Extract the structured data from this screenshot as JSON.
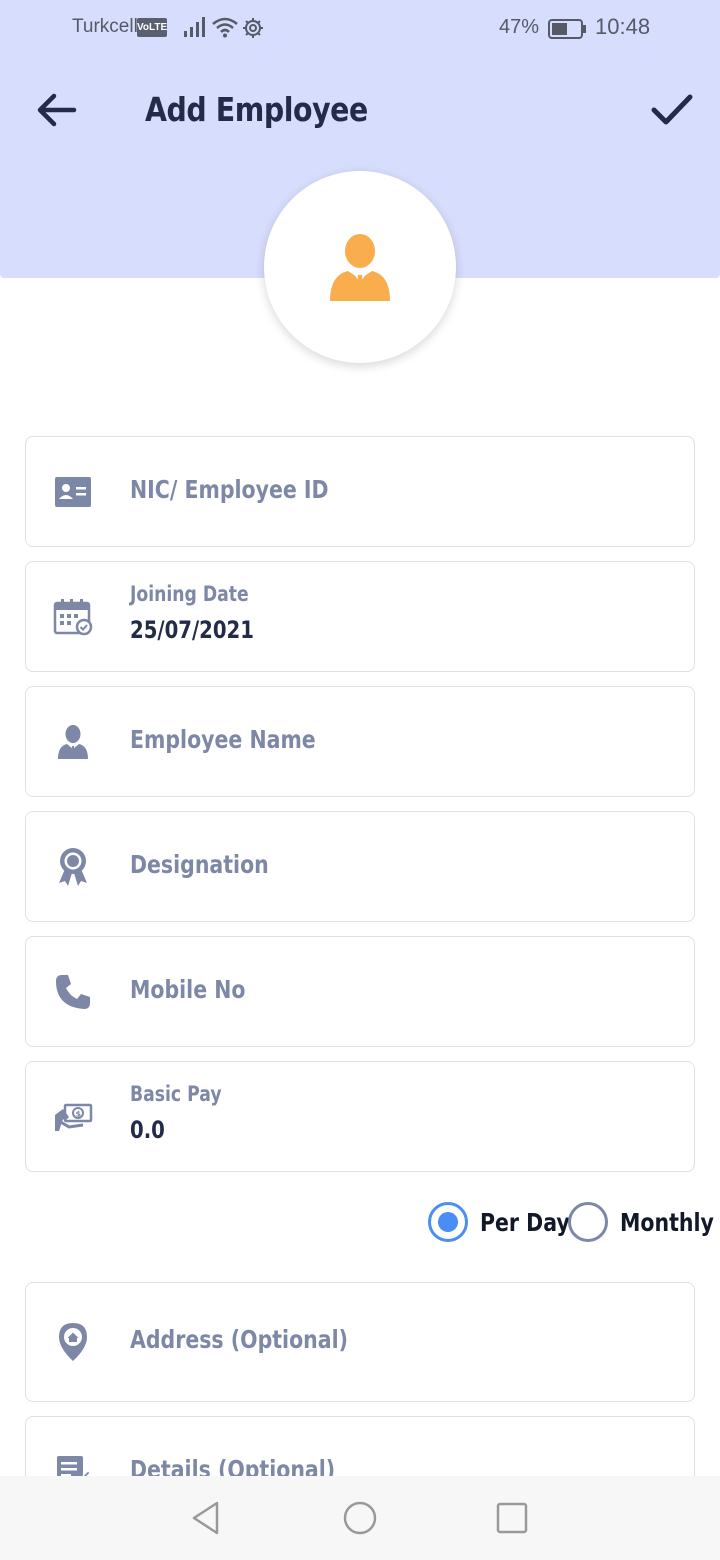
{
  "status_bar": {
    "carrier": "Turkcell",
    "network_badge": "VoLTE",
    "battery_percent": "47%",
    "time": "10:48"
  },
  "toolbar": {
    "title": "Add Employee",
    "back_icon": "arrow-left-icon",
    "save_icon": "check-icon"
  },
  "avatar": {
    "icon": "user-avatar-icon",
    "color": "#f9ad4c"
  },
  "form": {
    "nic": {
      "placeholder": "NIC/ Employee ID",
      "icon": "id-card-icon"
    },
    "joining_date": {
      "label": "Joining Date",
      "value": "25/07/2021",
      "icon": "calendar-icon"
    },
    "employee_name": {
      "placeholder": "Employee Name",
      "icon": "person-icon"
    },
    "designation": {
      "placeholder": "Designation",
      "icon": "award-icon"
    },
    "mobile": {
      "placeholder": "Mobile No",
      "icon": "phone-icon"
    },
    "basic_pay": {
      "label": "Basic Pay",
      "value": "0.0",
      "icon": "money-hand-icon"
    },
    "pay_period": {
      "options": [
        "Per Day",
        "Monthly"
      ],
      "selected": "Per Day"
    },
    "address": {
      "placeholder": "Address (Optional)",
      "icon": "location-pin-icon"
    },
    "details": {
      "placeholder": "Details (Optional)",
      "icon": "notes-icon"
    }
  },
  "colors": {
    "header_bg": "#d7ddfc",
    "title": "#222b48",
    "muted": "#7d87a6",
    "accent": "#4a8ef5",
    "avatar": "#f9ad4c"
  },
  "nav": {
    "back": "nav-back-icon",
    "home": "nav-home-icon",
    "recents": "nav-recents-icon"
  }
}
